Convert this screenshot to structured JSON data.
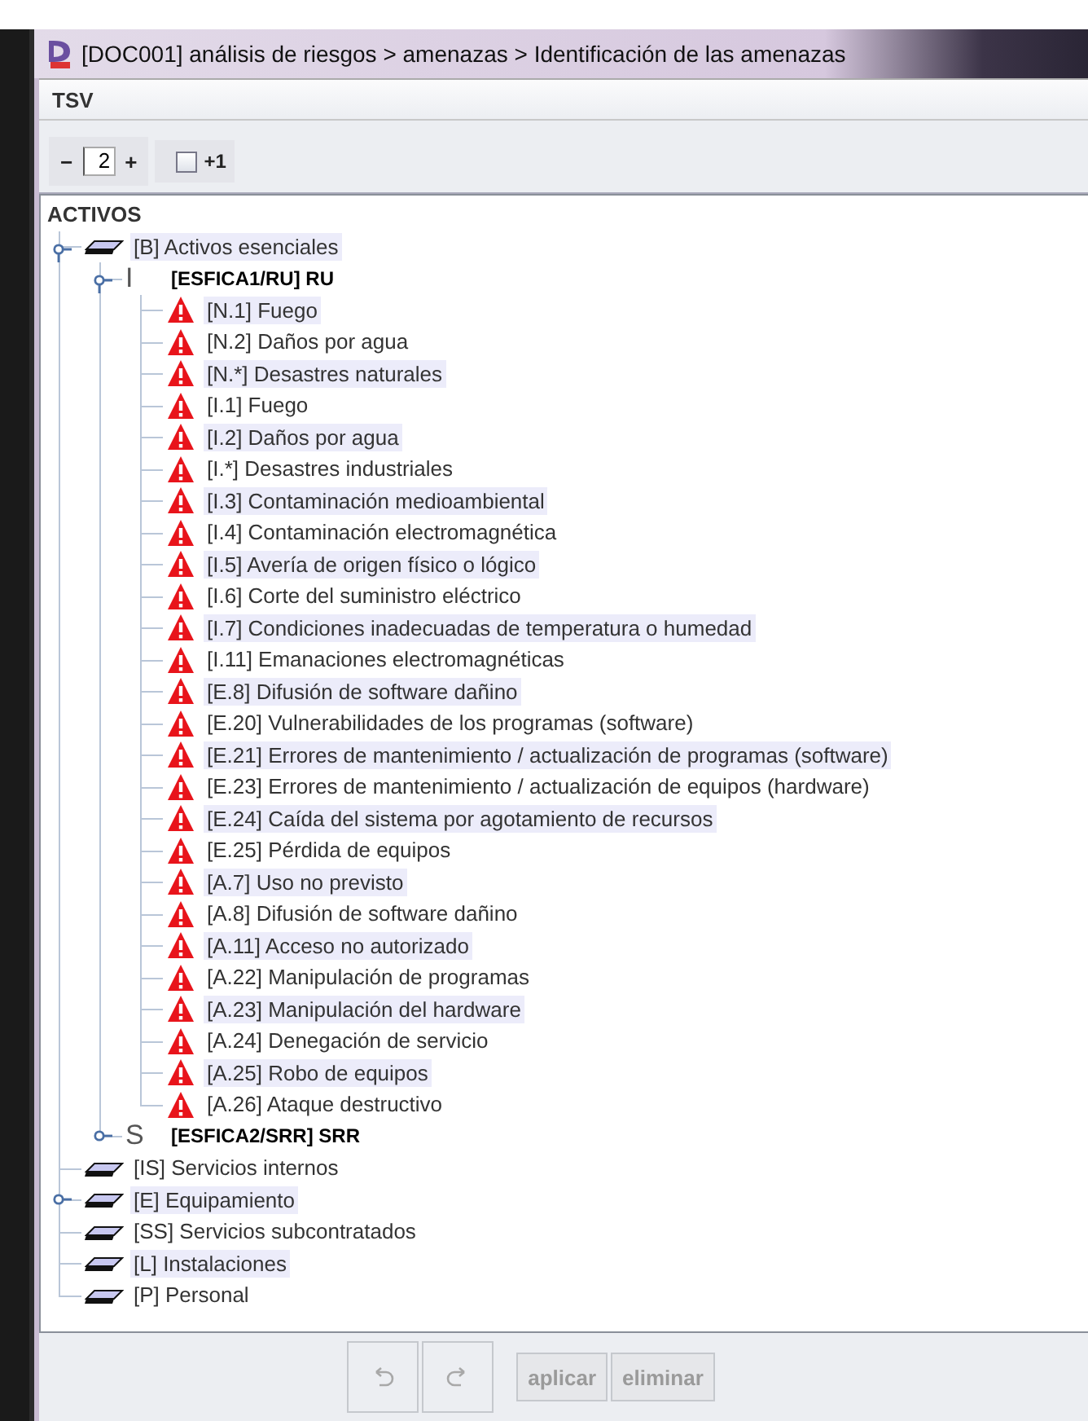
{
  "window": {
    "title": "[DOC001] análisis de riesgos > amenazas > Identificación de las amenazas"
  },
  "menu": [
    {
      "label": "TSV"
    }
  ],
  "toolbar": {
    "decrease": "−",
    "level_value": "2",
    "increase": "+",
    "plus_one": {
      "label": "+1",
      "checked": false
    }
  },
  "tree": {
    "label": "ACTIVOS",
    "children": [
      {
        "kind": "group",
        "label": "[B] Activos esenciales",
        "expanded": true,
        "children": [
          {
            "kind": "asset",
            "marker": "I",
            "label": "[ESFICA1/RU] RU",
            "expanded": true,
            "children": [
              {
                "kind": "threat",
                "label": "[N.1] Fuego"
              },
              {
                "kind": "threat",
                "label": "[N.2] Daños por agua"
              },
              {
                "kind": "threat",
                "label": "[N.*] Desastres naturales"
              },
              {
                "kind": "threat",
                "label": "[I.1] Fuego"
              },
              {
                "kind": "threat",
                "label": "[I.2] Daños por agua"
              },
              {
                "kind": "threat",
                "label": "[I.*] Desastres industriales"
              },
              {
                "kind": "threat",
                "label": "[I.3] Contaminación medioambiental"
              },
              {
                "kind": "threat",
                "label": "[I.4] Contaminación electromagnética"
              },
              {
                "kind": "threat",
                "label": "[I.5] Avería de origen físico o lógico"
              },
              {
                "kind": "threat",
                "label": "[I.6] Corte del suministro eléctrico"
              },
              {
                "kind": "threat",
                "label": "[I.7] Condiciones inadecuadas de temperatura o humedad"
              },
              {
                "kind": "threat",
                "label": "[I.11] Emanaciones electromagnéticas"
              },
              {
                "kind": "threat",
                "label": "[E.8] Difusión de software dañino"
              },
              {
                "kind": "threat",
                "label": "[E.20] Vulnerabilidades de los programas (software)"
              },
              {
                "kind": "threat",
                "label": "[E.21] Errores de mantenimiento / actualización de programas (software)"
              },
              {
                "kind": "threat",
                "label": "[E.23] Errores de mantenimiento / actualización de equipos (hardware)"
              },
              {
                "kind": "threat",
                "label": "[E.24] Caída del sistema por agotamiento de recursos"
              },
              {
                "kind": "threat",
                "label": "[E.25] Pérdida de equipos"
              },
              {
                "kind": "threat",
                "label": "[A.7] Uso no previsto"
              },
              {
                "kind": "threat",
                "label": "[A.8] Difusión de software dañino"
              },
              {
                "kind": "threat",
                "label": "[A.11] Acceso no autorizado"
              },
              {
                "kind": "threat",
                "label": "[A.22] Manipulación de programas"
              },
              {
                "kind": "threat",
                "label": "[A.23] Manipulación del hardware"
              },
              {
                "kind": "threat",
                "label": "[A.24] Denegación de servicio"
              },
              {
                "kind": "threat",
                "label": "[A.25] Robo de equipos"
              },
              {
                "kind": "threat",
                "label": "[A.26] Ataque destructivo"
              }
            ]
          },
          {
            "kind": "asset",
            "marker": "S",
            "label": "[ESFICA2/SRR] SRR",
            "expanded": false
          }
        ]
      },
      {
        "kind": "group",
        "label": "[IS] Servicios internos"
      },
      {
        "kind": "group",
        "label": "[E] Equipamiento",
        "expanded": false
      },
      {
        "kind": "group",
        "label": "[SS] Servicios subcontratados"
      },
      {
        "kind": "group",
        "label": "[L] Instalaciones"
      },
      {
        "kind": "group",
        "label": "[P] Personal"
      }
    ]
  },
  "buttons": [
    {
      "kind": "undo",
      "disabled": true
    },
    {
      "kind": "redo",
      "disabled": true
    },
    {
      "kind": "text",
      "label": "aplicar",
      "disabled": true
    },
    {
      "kind": "text",
      "label": "eliminar",
      "disabled": true
    }
  ]
}
